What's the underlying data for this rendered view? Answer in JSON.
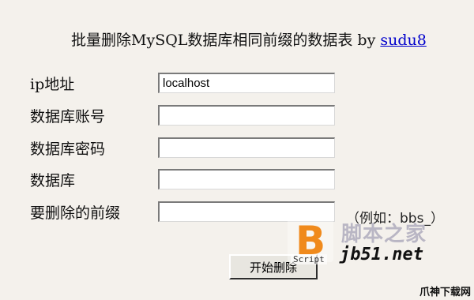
{
  "header": {
    "title": "批量删除MySQL数据库相同前缀的数据表",
    "by_text": "by",
    "author_link": "sudu8"
  },
  "form": {
    "fields": [
      {
        "label": "ip地址",
        "value": "localhost",
        "placeholder": ""
      },
      {
        "label": "数据库账号",
        "value": "",
        "placeholder": ""
      },
      {
        "label": "数据库密码",
        "value": "",
        "placeholder": ""
      },
      {
        "label": "数据库",
        "value": "",
        "placeholder": ""
      },
      {
        "label": "要删除的前缀",
        "value": "",
        "placeholder": ""
      }
    ],
    "prefix_hint": "（例如：bbs_）",
    "submit_label": "开始删除"
  },
  "watermark": {
    "logo_letter": "B",
    "script_text": "Script",
    "site_name_cn": "脚本之家",
    "site_url": "jb51.net",
    "corner_text": "爪神下载网",
    "logo_color": "#f08a1c"
  }
}
